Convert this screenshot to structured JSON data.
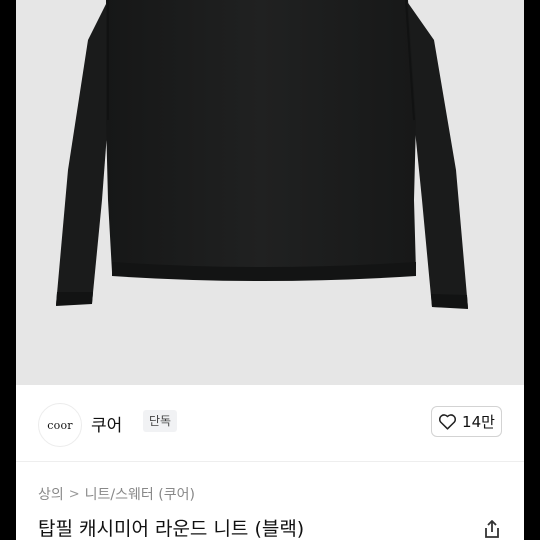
{
  "product": {
    "image_icon": "black-cashmere-sweater-photo"
  },
  "brand": {
    "logo_text": "coor",
    "name": "쿠어",
    "badge": "단독"
  },
  "likes": {
    "icon": "heart-outline-icon",
    "count": "14만"
  },
  "breadcrumb": {
    "items": [
      "상의",
      "니트/스웨터 (쿠어)"
    ],
    "separator": ">"
  },
  "title": "탑필 캐시미어 라운드 니트 (블랙)",
  "share": {
    "icon": "share-icon"
  },
  "colors": {
    "image_background": "#e6e6e6",
    "sweater": "#1b1c1c",
    "text_primary": "#111111",
    "text_secondary": "#888888",
    "badge_background": "#f1f2f4"
  }
}
